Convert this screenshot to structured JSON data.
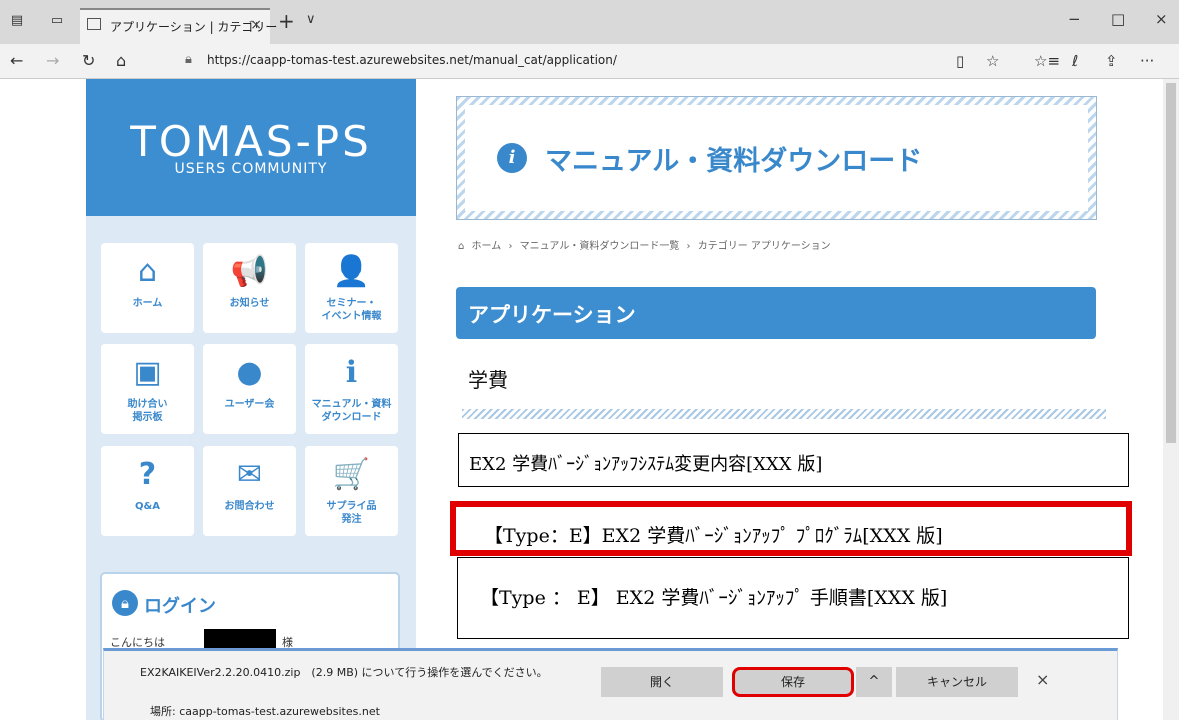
{
  "browser": {
    "tab_title": "アプリケーション | カテゴリー",
    "tab_close": "×",
    "new_tab": "+",
    "tab_menu": "∨",
    "minimize": "−",
    "maximize": "□",
    "close": "×",
    "back": "←",
    "forward": "→",
    "refresh": "↻",
    "home": "⌂",
    "url": "https://caapp-tomas-test.azurewebsites.net/manual_cat/application/",
    "reading_view": "▯",
    "favorite": "☆",
    "favorites_list": "☆≡",
    "notes": "ℓ",
    "share": "⇪",
    "more": "···"
  },
  "sidebar": {
    "logo_main": "TOMAS-PS",
    "logo_sub": "USERS COMMUNITY",
    "tiles": [
      {
        "label": "ホーム",
        "icon": "⌂"
      },
      {
        "label": "お知らせ",
        "icon": "📢"
      },
      {
        "label": "セミナー・\nイベント情報",
        "icon": "👤"
      },
      {
        "label": "助け合い\n掲示板",
        "icon": "▣"
      },
      {
        "label": "ユーザー会",
        "icon": "●"
      },
      {
        "label": "マニュアル・資料\nダウンロード",
        "icon": "ℹ"
      },
      {
        "label": "Q&A",
        "icon": "?"
      },
      {
        "label": "お問合わせ",
        "icon": "✉"
      },
      {
        "label": "サプライ品\n発注",
        "icon": "🛒"
      }
    ],
    "login": {
      "title": "ログイン",
      "greeting": "こんにちは",
      "sama": "様"
    }
  },
  "main": {
    "banner_title": "マニュアル・資料ダウンロード",
    "banner_icon": "i",
    "breadcrumb": [
      "ホーム",
      "›",
      "マニュアル・資料ダウンロード一覧",
      "›",
      "カテゴリー アプリケーション"
    ],
    "category_heading": "アプリケーション",
    "subcategory": "学費",
    "documents": [
      "EX2 学費ﾊﾞｰｼﾞｮﾝｱｯﾌｼｽﾃﾑ変更内容[XXX 版]",
      "【Type：E】EX2 学費ﾊﾞｰｼﾞｮﾝｱｯﾌﾟ ﾌﾟﾛｸﾞﾗﾑ[XXX 版]",
      "【Type ： E】 EX2 学費ﾊﾞｰｼﾞｮﾝｱｯﾌﾟ 手順書[XXX 版]"
    ]
  },
  "download_bar": {
    "message": "EX2KAIKEIVer2.2.20.0410.zip　(2.9 MB) について行う操作を選んでください。",
    "location": "場所: caapp-tomas-test.azurewebsites.net",
    "open": "開く",
    "save": "保存",
    "more": "^",
    "cancel": "キャンセル",
    "close": "×"
  }
}
